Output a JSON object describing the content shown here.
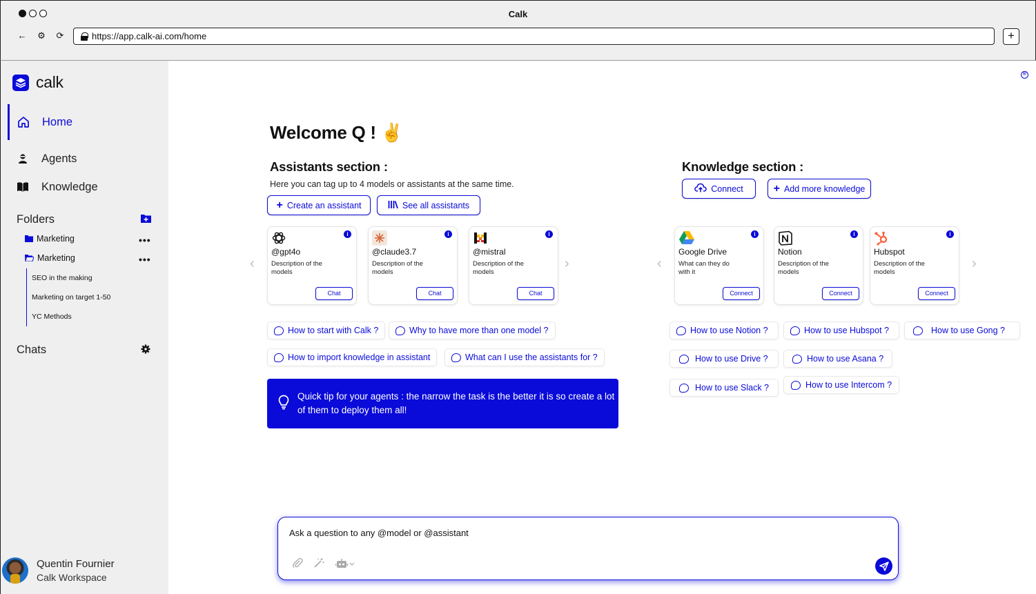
{
  "browser": {
    "title": "Calk",
    "url": "https://app.calk-ai.com/home",
    "new_tab_label": "+"
  },
  "sidebar": {
    "logo_text": "calk",
    "nav": [
      {
        "label": "Home",
        "icon": "home-icon",
        "active": true
      },
      {
        "label": "Agents",
        "icon": "agent-icon"
      },
      {
        "label": "Knowledge",
        "icon": "book-icon"
      }
    ],
    "folders_heading": "Folders",
    "folders": [
      {
        "label": "Marketing",
        "icon": "folder-icon"
      },
      {
        "label": "Marketing",
        "icon": "folder-open-icon"
      }
    ],
    "subfolders": [
      "SEO in the making",
      "Marketing on target 1-50",
      "YC Methods"
    ],
    "chats_heading": "Chats",
    "user": {
      "name": "Quentin Fournier",
      "workspace": "Calk Workspace"
    }
  },
  "main": {
    "welcome": "Welcome Q ! ✌️",
    "assistants": {
      "heading": "Assistants section :",
      "subtitle": "Here you can tag up to 4 models or assistants at the same time.",
      "create_button": "Create an assistant",
      "see_all_button": "See all assistants",
      "cards": [
        {
          "name": "@gpt4o",
          "description": "Description of the models",
          "button": "Chat",
          "icon": "openai-icon"
        },
        {
          "name": "@claude3.7",
          "description": "Description of the models",
          "button": "Chat",
          "icon": "claude-icon"
        },
        {
          "name": "@mistral",
          "description": "Description of the models",
          "button": "Chat",
          "icon": "mistral-icon"
        }
      ],
      "chips": [
        "How to start with Calk ?",
        "Why to have more than one model ?",
        "How to import knowledge in assistant",
        "What can I use the assistants for ?"
      ]
    },
    "knowledge": {
      "heading": "Knowledge section :",
      "connect_button": "Connect",
      "add_button": "Add more knowledge",
      "cards": [
        {
          "name": "Google Drive",
          "description": "What can they do with it",
          "button": "Connect",
          "icon": "google-drive-icon"
        },
        {
          "name": "Notion",
          "description": "Description of the models",
          "button": "Connect",
          "icon": "notion-icon"
        },
        {
          "name": "Hubspot",
          "description": "Description of the models",
          "button": "Connect",
          "icon": "hubspot-icon"
        }
      ],
      "chips": [
        "How to use Notion ?",
        "How to use Hubspot ?",
        "How to use Gong ?",
        "How to use Drive ?",
        "How to use Asana ?",
        "How to use Slack ?",
        "How to use Intercom ?"
      ]
    },
    "tip": "Quick tip for your agents : the narrow the task is the better it is so create a lot of them to deploy them all!",
    "composer": {
      "placeholder": "Ask a question to any @model or @assistant"
    }
  },
  "colors": {
    "accent": "#0a0ad9",
    "sidebar_bg": "#efefef"
  }
}
